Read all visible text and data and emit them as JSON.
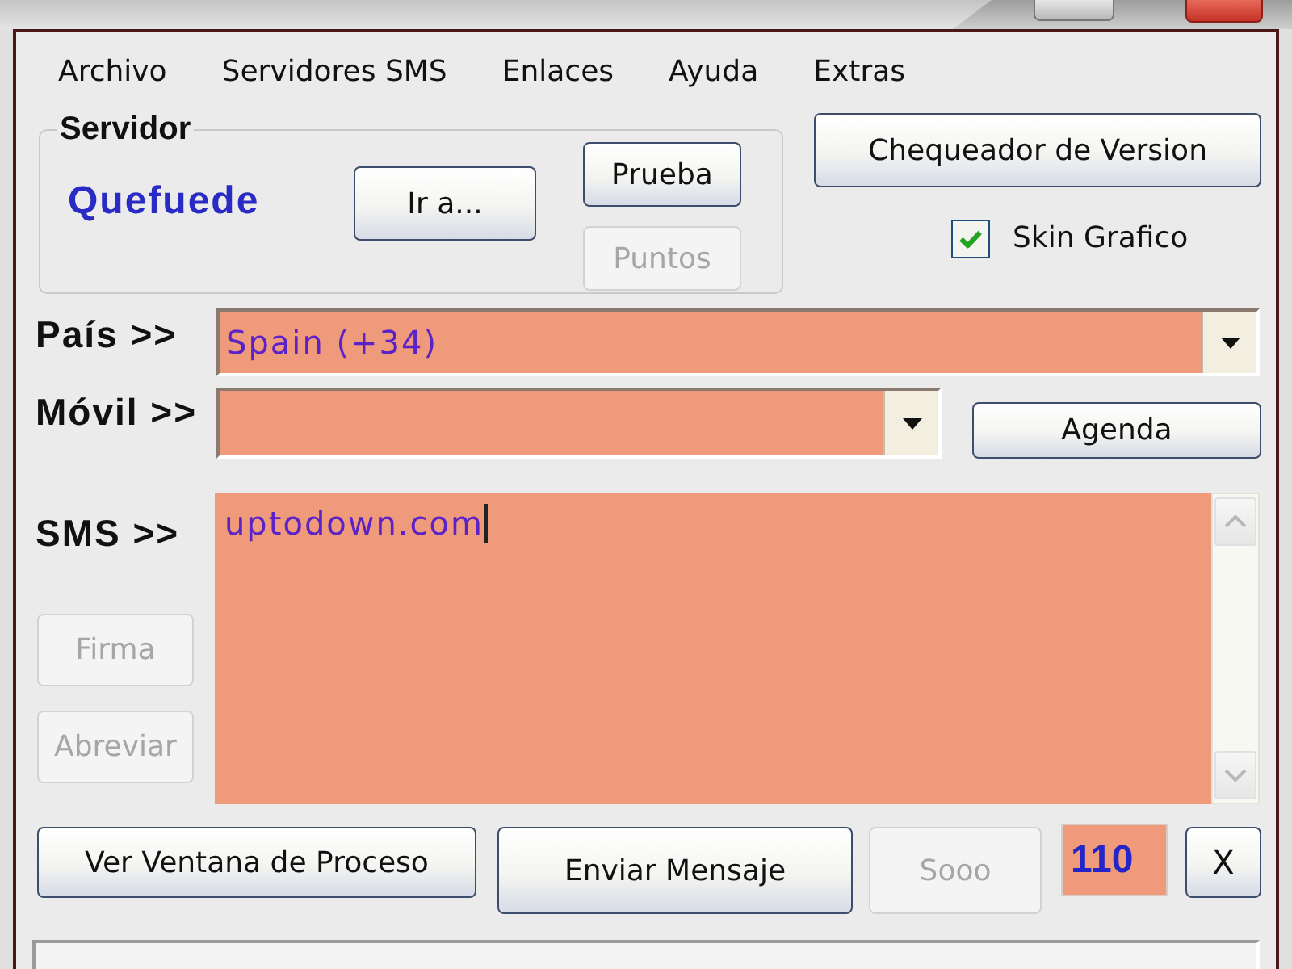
{
  "menu": [
    "Archivo",
    "Servidores SMS",
    "Enlaces",
    "Ayuda",
    "Extras"
  ],
  "server_group": {
    "legend": "Servidor",
    "server_name": "Quefuede",
    "buttons": [
      {
        "label": "Ir a...",
        "disabled": false
      },
      {
        "label": "Prueba",
        "disabled": false
      },
      {
        "label": "Puntos",
        "disabled": true
      }
    ]
  },
  "version_button": {
    "label": "Chequeador de Version"
  },
  "skin_checkbox": {
    "label": "Skin Grafico",
    "checked": true
  },
  "country": {
    "label": "País >>",
    "value": "Spain (+34)"
  },
  "mobile": {
    "label": "Móvil >>"
  },
  "agenda_button": {
    "label": "Agenda"
  },
  "sms": {
    "label": "SMS >>",
    "value": "uptodown.com"
  },
  "side_buttons": [
    {
      "label": "Firma",
      "disabled": true
    },
    {
      "label": "Abreviar",
      "disabled": true
    }
  ],
  "bottom_buttons": [
    {
      "label": "Ver Ventana de Proceso",
      "disabled": false
    },
    {
      "label": "Enviar Mensaje",
      "disabled": false
    },
    {
      "label": "Sooo",
      "disabled": true
    }
  ],
  "counter": {
    "value": "110"
  },
  "clear_button": {
    "label": "X"
  }
}
